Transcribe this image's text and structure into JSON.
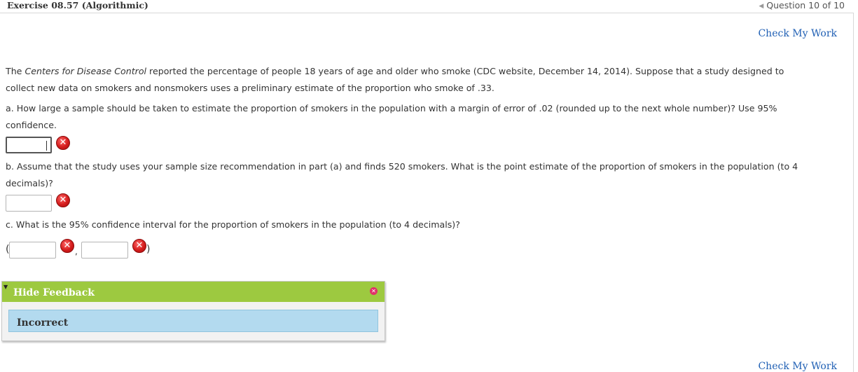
{
  "header": {
    "exercise_title": "Exercise 08.57 (Algorithmic)",
    "question_nav": "Question 10 of 10"
  },
  "check_my_work": "Check My Work",
  "problem": {
    "intro_prefix": "The ",
    "intro_source": "Centers for Disease Control",
    "intro_line1_rest": " reported the percentage of people 18 years of age and older who smoke (CDC website, December 14, 2014). Suppose that a study designed to",
    "intro_line2": "collect new data on smokers and nonsmokers uses a preliminary estimate of the proportion who smoke of .33.",
    "part_a_line1": "a. How large a sample should be taken to estimate the proportion of smokers in the population with a margin of error of .02 (rounded up to the next whole number)? Use 95%",
    "part_a_line2": "confidence.",
    "part_b_line1": "b. Assume that the study uses your sample size recommendation in part (a) and finds 520 smokers. What is the point estimate of the proportion of smokers in the population (to 4",
    "part_b_line2": "decimals)?",
    "part_c": "c. What is the 95% confidence interval for the proportion of smokers in the population (to 4 decimals)?",
    "open_paren": "(",
    "comma": ",",
    "close_paren": ")"
  },
  "answers": {
    "part_a_value": "",
    "part_b_value": "",
    "part_c_lower": "",
    "part_c_upper": ""
  },
  "feedback": {
    "toggle_label": "Hide Feedback",
    "result": "Incorrect"
  },
  "icons": {
    "incorrect": "x-circle-icon",
    "close": "close-icon",
    "previous": "triangle-left-icon",
    "collapse": "triangle-down-icon"
  },
  "colors": {
    "link": "#1f5fb4",
    "feedback_bar": "#9dc940",
    "feedback_result_bg": "#b3daef",
    "error_red": "#d41c1c"
  }
}
